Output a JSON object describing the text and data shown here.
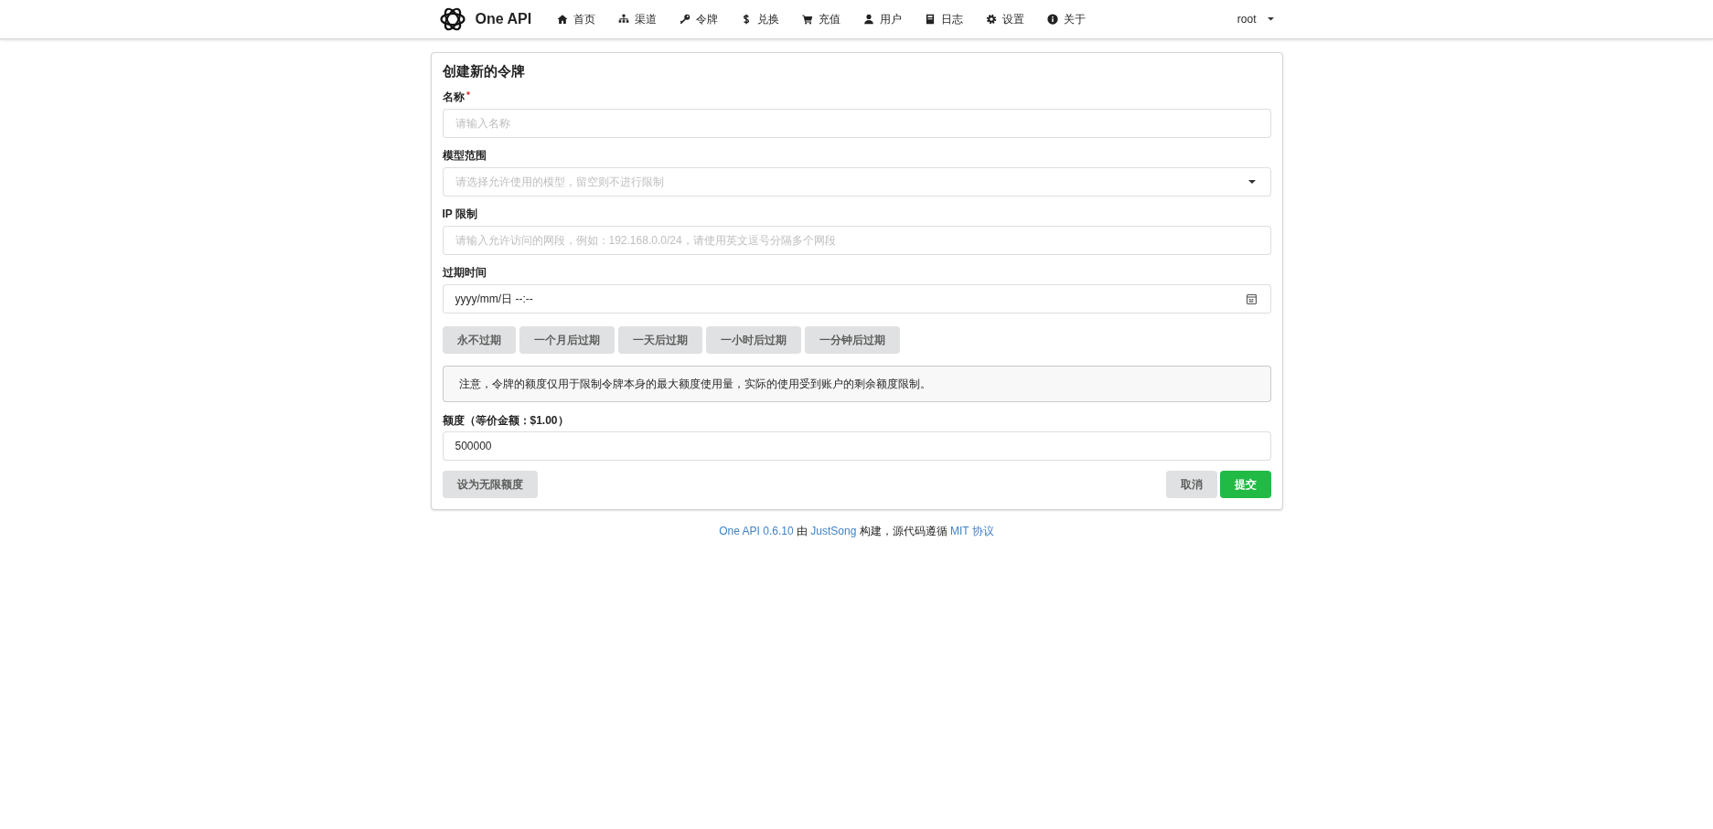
{
  "header": {
    "brand": "One API",
    "nav": [
      {
        "kind": "home",
        "label": "首页"
      },
      {
        "kind": "sitemap",
        "label": "渠道"
      },
      {
        "kind": "key",
        "label": "令牌"
      },
      {
        "kind": "dollar",
        "label": "兑换"
      },
      {
        "kind": "cart",
        "label": "充值"
      },
      {
        "kind": "user",
        "label": "用户"
      },
      {
        "kind": "book",
        "label": "日志"
      },
      {
        "kind": "gear",
        "label": "设置"
      },
      {
        "kind": "info",
        "label": "关于"
      }
    ],
    "user_menu": {
      "label": "root"
    }
  },
  "form": {
    "title": "创建新的令牌",
    "fields": [
      {
        "kind": "text",
        "label": "名称",
        "required": true,
        "placeholder": "请输入名称"
      },
      {
        "kind": "dropdown",
        "label": "模型范围",
        "required": false,
        "placeholder": "请选择允许使用的模型，留空则不进行限制"
      },
      {
        "kind": "text",
        "label": "IP 限制",
        "required": false,
        "placeholder": "请输入允许访问的网段，例如：192.168.0.0/24，请使用英文逗号分隔多个网段"
      },
      {
        "kind": "datetime",
        "label": "过期时间",
        "required": false,
        "placeholder": "yyyy/mm/日 --:--"
      }
    ],
    "expiry_buttons": [
      "永不过期",
      "一个月后过期",
      "一天后过期",
      "一小时后过期",
      "一分钟后过期"
    ],
    "note": "注意，令牌的额度仅用于限制令牌本身的最大额度使用量，实际的使用受到账户的剩余额度限制。",
    "quota": {
      "label": "额度（等价金额：$1.00）",
      "value": "500000"
    },
    "actions": {
      "left": [
        {
          "label": "设为无限额度",
          "kind": "secondary"
        }
      ],
      "right": [
        {
          "label": "取消",
          "kind": "secondary"
        },
        {
          "label": "提交",
          "kind": "primary"
        }
      ]
    }
  },
  "footer": {
    "parts": [
      {
        "text": "One API 0.6.10",
        "link": true
      },
      {
        "text": "由",
        "link": false
      },
      {
        "text": "JustSong",
        "link": true
      },
      {
        "text": "构建，源代码遵循",
        "link": false
      },
      {
        "text": "MIT 协议",
        "link": true
      }
    ]
  }
}
